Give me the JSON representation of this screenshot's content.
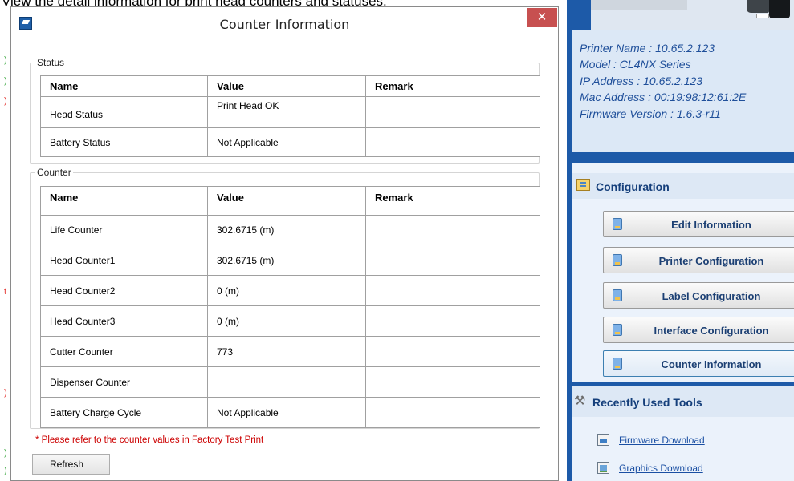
{
  "caption": "View the detail information for print head counters and statuses.",
  "dialog": {
    "title": "Counter Information",
    "close_glyph": "✕",
    "status_group": {
      "label": "Status",
      "columns": [
        "Name",
        "Value",
        "Remark"
      ],
      "rows": [
        {
          "name": "Head Status",
          "value": "Print Head OK",
          "remark": ""
        },
        {
          "name": "Battery Status",
          "value": "Not Applicable",
          "remark": ""
        }
      ]
    },
    "counter_group": {
      "label": "Counter",
      "columns": [
        "Name",
        "Value",
        "Remark"
      ],
      "rows": [
        {
          "name": "Life Counter",
          "value": "302.6715 (m)",
          "remark": ""
        },
        {
          "name": "Head Counter1",
          "value": "302.6715 (m)",
          "remark": ""
        },
        {
          "name": "Head Counter2",
          "value": "0 (m)",
          "remark": ""
        },
        {
          "name": "Head Counter3",
          "value": "0 (m)",
          "remark": ""
        },
        {
          "name": "Cutter Counter",
          "value": "773",
          "remark": ""
        },
        {
          "name": "Dispenser Counter",
          "value": "",
          "remark": ""
        },
        {
          "name": "Battery Charge Cycle",
          "value": "Not Applicable",
          "remark": ""
        }
      ]
    },
    "note": "* Please refer to the counter values in Factory Test Print",
    "refresh_label": "Refresh"
  },
  "sidebar": {
    "printer_info": {
      "printer_name": "Printer Name : 10.65.2.123",
      "model": "Model : CL4NX Series",
      "ip_address": "IP Address : 10.65.2.123",
      "mac_address": "Mac Address : 00:19:98:12:61:2E",
      "firmware_version": "Firmware Version : 1.6.3-r11"
    },
    "configuration": {
      "title": "Configuration",
      "buttons": [
        {
          "label": "Edit Information"
        },
        {
          "label": "Printer Configuration"
        },
        {
          "label": "Label Configuration"
        },
        {
          "label": "Interface Configuration"
        },
        {
          "label": "Counter Information",
          "selected": true
        }
      ]
    },
    "tools": {
      "title": "Recently Used Tools",
      "icon_glyph": "⚒",
      "links": [
        {
          "label": "Firmware Download"
        },
        {
          "label": "Graphics Download"
        }
      ]
    }
  },
  "colors": {
    "sidebar_blue": "#1d5aa8",
    "link_blue": "#1a4fa3",
    "note_red": "#cc0000",
    "close_red": "#c75050"
  }
}
